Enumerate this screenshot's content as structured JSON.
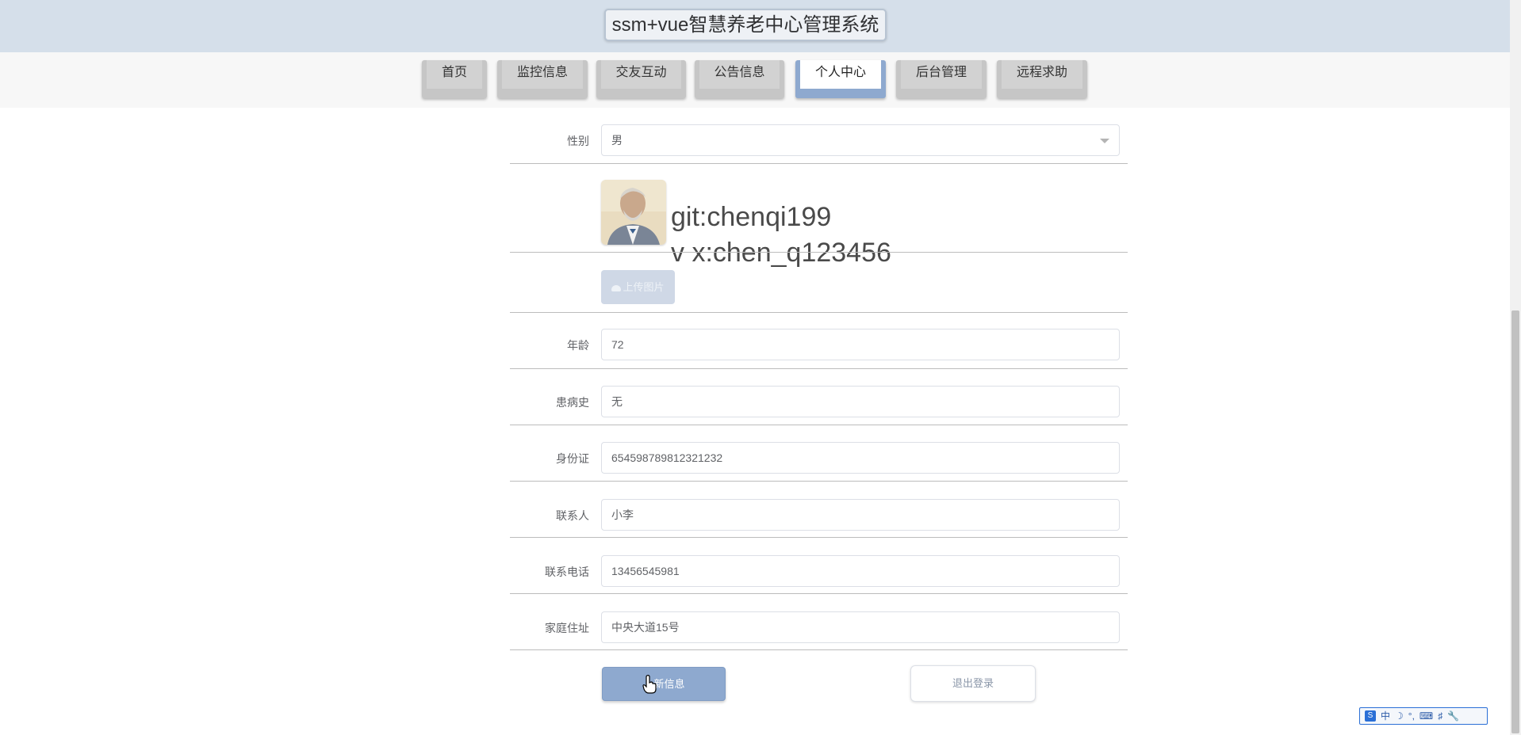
{
  "header": {
    "title": "ssm+vue智慧养老中心管理系统"
  },
  "nav": {
    "items": [
      {
        "label": "首页"
      },
      {
        "label": "监控信息"
      },
      {
        "label": "交友互动"
      },
      {
        "label": "公告信息"
      },
      {
        "label": "个人中心",
        "active": true
      },
      {
        "label": "后台管理"
      },
      {
        "label": "远程求助"
      }
    ]
  },
  "form": {
    "gender": {
      "label": "性别",
      "value": "男"
    },
    "upload_label": "上传图片",
    "watermark": {
      "line1": "git:chenqi199",
      "line2": "v x:chen_q123456"
    },
    "age": {
      "label": "年龄",
      "value": "72"
    },
    "history": {
      "label": "患病史",
      "value": "无"
    },
    "id_card": {
      "label": "身份证",
      "value": "654598789812321232"
    },
    "contact": {
      "label": "联系人",
      "value": "小李"
    },
    "phone": {
      "label": "联系电话",
      "value": "13456545981"
    },
    "address": {
      "label": "家庭住址",
      "value": "中央大道15号"
    }
  },
  "actions": {
    "update_label": "新信息",
    "logout_label": "退出登录"
  },
  "ime": {
    "lang": "中"
  },
  "colors": {
    "accent": "#8ea9cf",
    "header_bg": "#d5dfea",
    "nav_inactive": "#c6c6c6"
  }
}
